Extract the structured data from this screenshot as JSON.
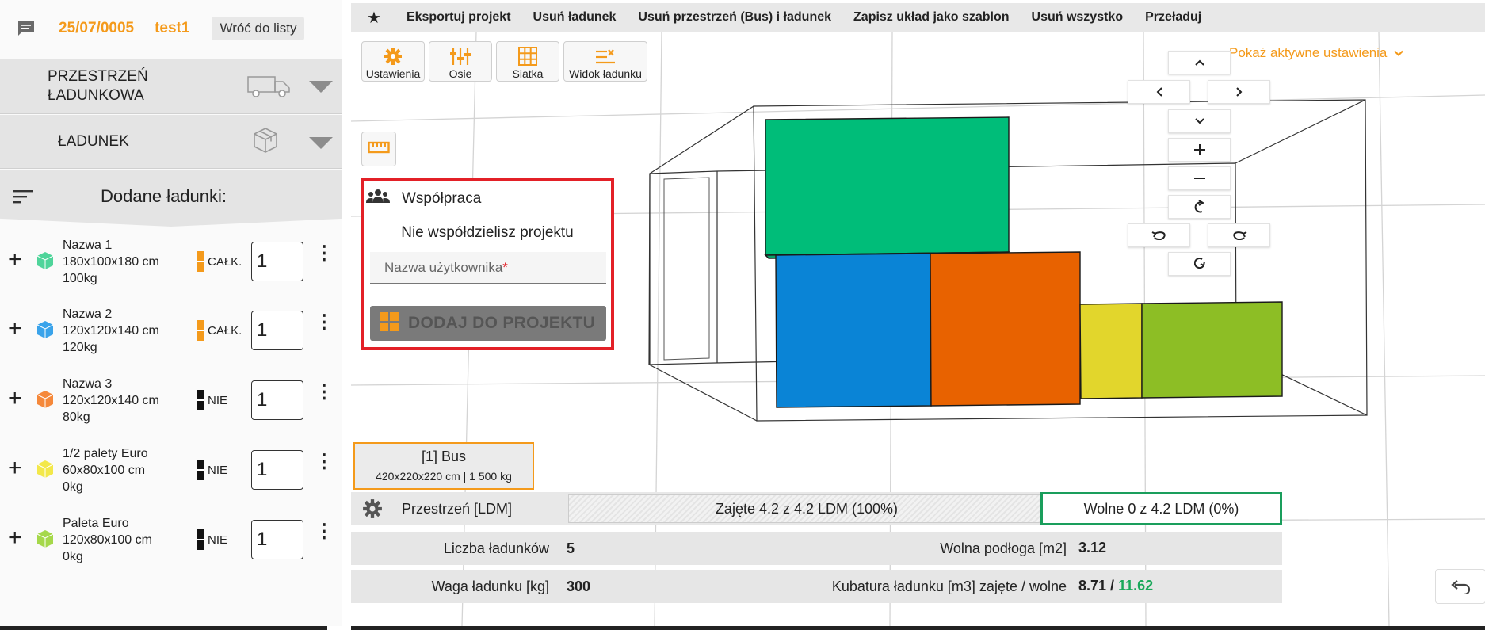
{
  "header": {
    "project_number": "25/07/0005",
    "project_name": "test1",
    "back_label": "Wróć do listy"
  },
  "sections": {
    "space_label": "PRZESTRZEŃ ŁADUNKOWA",
    "cargo_label": "ŁADUNEK",
    "added_title": "Dodane ładunki:"
  },
  "cargo_items": [
    {
      "name": "Nazwa 1",
      "dims": "180x100x180 cm",
      "weight": "100kg",
      "stack": "CAŁK.",
      "qty": "1",
      "color": "#4fd49a"
    },
    {
      "name": "Nazwa 2",
      "dims": "120x120x140 cm",
      "weight": "120kg",
      "stack": "CAŁK.",
      "qty": "1",
      "color": "#3aa3ea"
    },
    {
      "name": "Nazwa 3",
      "dims": "120x120x140 cm",
      "weight": "80kg",
      "stack": "NIE",
      "qty": "1",
      "color": "#f5883a"
    },
    {
      "name": "1/2 palety Euro",
      "dims": "60x80x100 cm",
      "weight": "0kg",
      "stack": "NIE",
      "qty": "1",
      "color": "#f3e84a"
    },
    {
      "name": "Paleta Euro",
      "dims": "120x80x100 cm",
      "weight": "0kg",
      "stack": "NIE",
      "qty": "1",
      "color": "#a5d84a"
    }
  ],
  "topbar": [
    "Eksportuj projekt",
    "Usuń ładunek",
    "Usuń przestrzeń (Bus) i ładunek",
    "Zapisz układ jako szablon",
    "Usuń wszystko",
    "Przeładuj"
  ],
  "tools": {
    "settings": "Ustawienia",
    "axes": "Osie",
    "grid": "Siatka",
    "cargo_view": "Widok ładunku"
  },
  "show_settings": "Pokaż aktywne ustawienia",
  "collab": {
    "title": "Współpraca",
    "message": "Nie współdzielisz projektu",
    "username_label": "Nazwa użytkownika",
    "required_mark": "*",
    "add_button": "DODAJ DO PROJEKTU"
  },
  "bus": {
    "name": "[1] Bus",
    "dims": "420x220x220 cm | 1 500 kg"
  },
  "ldm": {
    "label": "Przestrzeń [LDM]",
    "occupied": "Zajęte 4.2 z 4.2 LDM (100%)",
    "free": "Wolne 0 z 4.2 LDM (0%)"
  },
  "stats": {
    "count_label": "Liczba ładunków",
    "count_value": "5",
    "floor_label": "Wolna podłoga [m2]",
    "floor_value": "3.12",
    "weight_label": "Waga ładunku [kg]",
    "weight_value": "300",
    "volume_label": "Kubatura ładunku [m3] zajęte / wolne",
    "volume_used": "8.71",
    "volume_sep": " / ",
    "volume_free": "11.62"
  },
  "colors": {
    "accent": "#f49a1b",
    "highlight_border": "#e32027",
    "free_border": "#1a9e5c",
    "box_green": "#00bd79",
    "box_blue": "#0a84d6",
    "box_orange": "#e86200",
    "box_yellow": "#e2d62c",
    "box_lime": "#8dbe25"
  },
  "icons": [
    "chat-icon",
    "truck-icon",
    "box-icon",
    "sort-icon",
    "star-icon",
    "gear-icon",
    "axes-icon",
    "grid-icon",
    "cargo-view-icon",
    "ruler-icon",
    "people-icon",
    "undo-icon"
  ]
}
